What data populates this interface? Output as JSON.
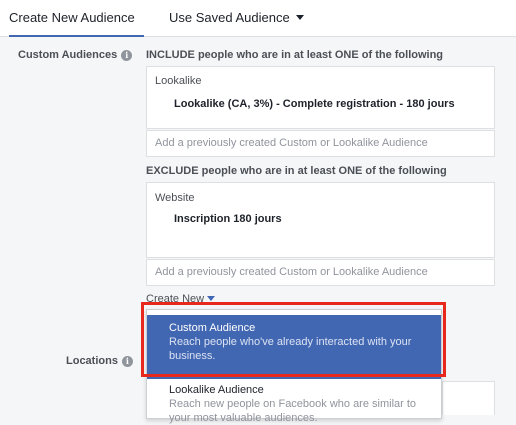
{
  "tabs": [
    {
      "label": "Create New Audience"
    },
    {
      "label": "Use Saved Audience"
    }
  ],
  "custom_audiences": {
    "label": "Custom Audiences",
    "include_title": "INCLUDE people who are in at least ONE of the following",
    "include": {
      "category": "Lookalike",
      "item": "Lookalike (CA, 3%) - Complete registration - 180 jours"
    },
    "include_placeholder": "Add a previously created Custom or Lookalike Audience",
    "exclude_title": "EXCLUDE people who are in at least ONE of the following",
    "exclude": {
      "category": "Website",
      "item": "Inscription 180 jours"
    },
    "exclude_placeholder": "Add a previously created Custom or Lookalike Audience",
    "create_new_label": "Create New"
  },
  "dropdown": {
    "items": [
      {
        "title": "Custom Audience",
        "desc": "Reach people who've already interacted with your business."
      },
      {
        "title": "Lookalike Audience",
        "desc": "Reach new people on Facebook who are similar to your most valuable audiences."
      }
    ]
  },
  "locations": {
    "label": "Locations"
  },
  "colors": {
    "accent": "#4267b2",
    "highlight": "#e8281d"
  }
}
